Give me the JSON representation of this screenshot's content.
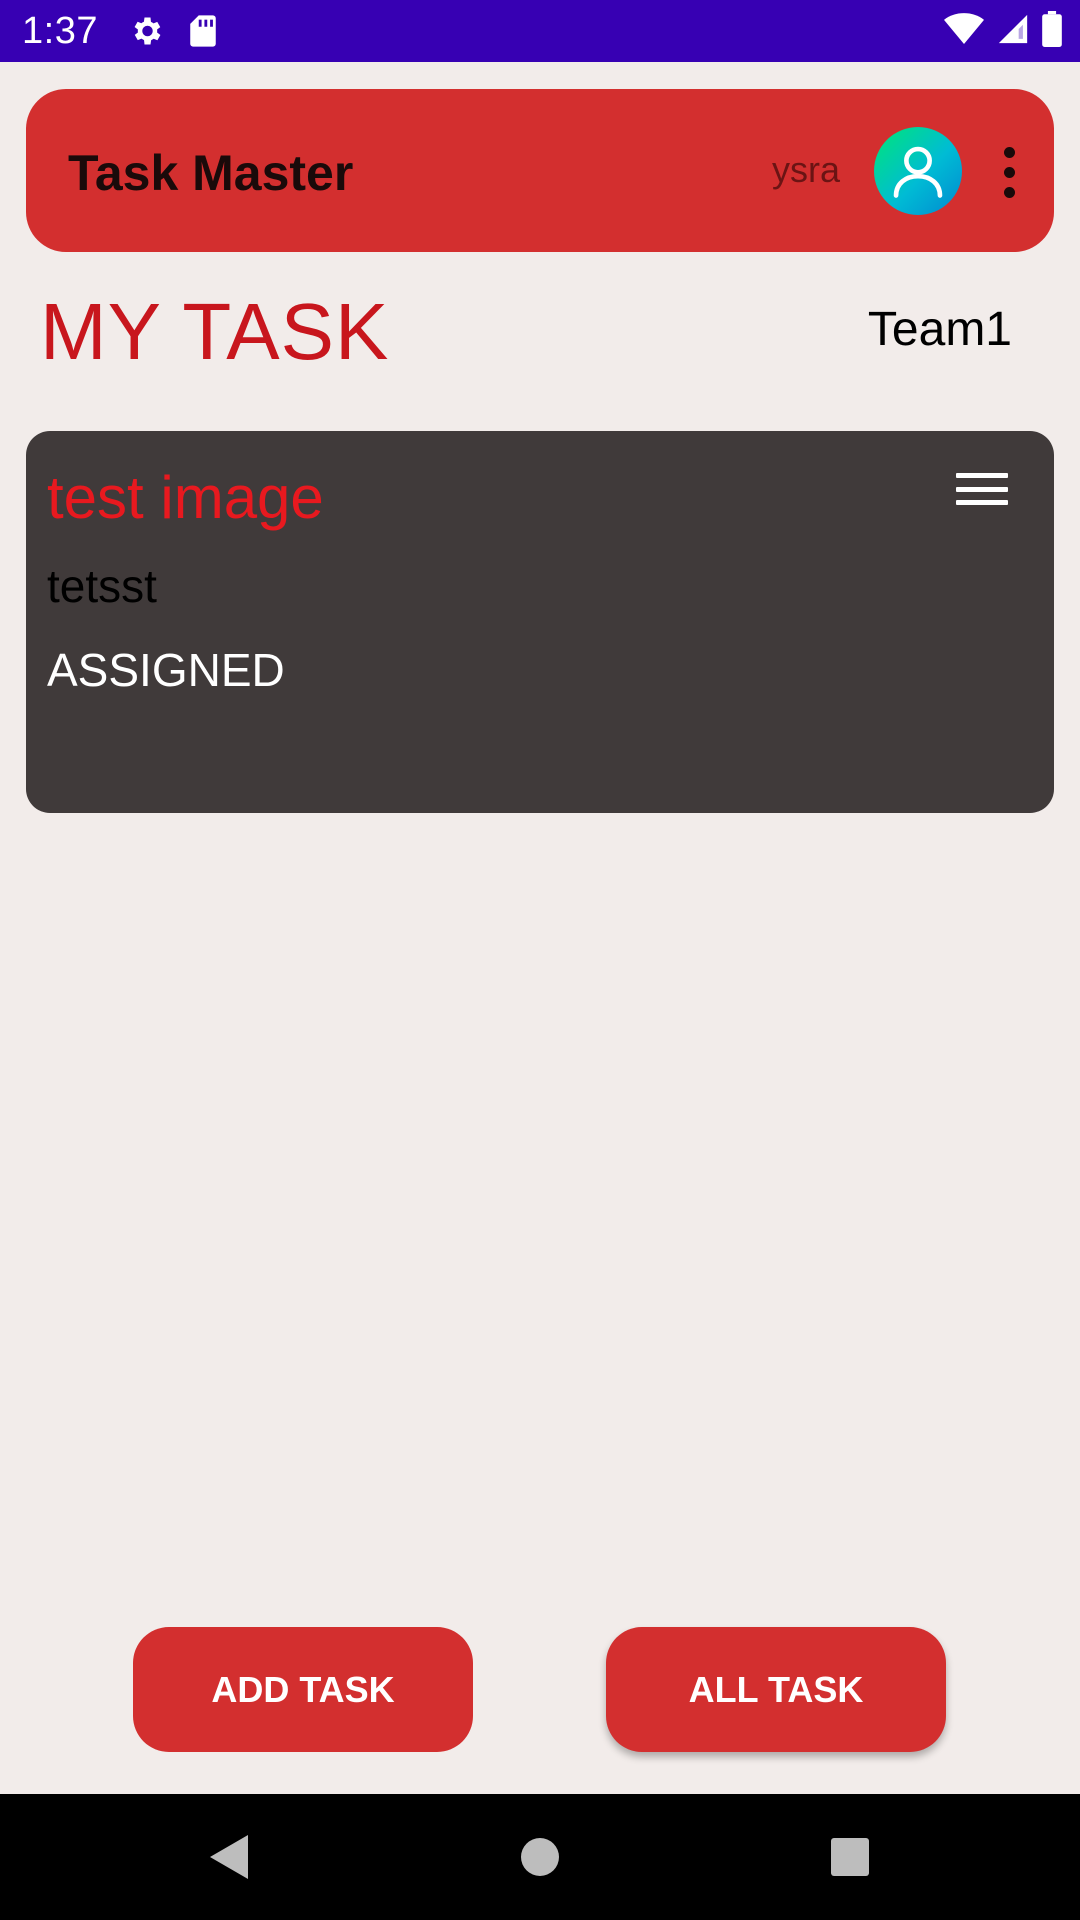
{
  "status_bar": {
    "time": "1:37",
    "icons": [
      "gear-icon",
      "sd-card-icon",
      "wifi-icon",
      "cellular-signal-icon",
      "battery-icon"
    ],
    "background": "#3700b3"
  },
  "app_bar": {
    "title": "Task Master",
    "username": "ysra",
    "avatar_icon": "user-avatar-icon",
    "more_icon": "more-vert-icon",
    "background": "#d32f2f"
  },
  "section": {
    "title": "MY TASK",
    "team": "Team1"
  },
  "tasks": [
    {
      "title": "test image",
      "description": "tetsst",
      "status": "ASSIGNED",
      "menu_icon": "hamburger-menu-icon"
    }
  ],
  "buttons": {
    "add_task": "ADD TASK",
    "all_task": "ALL TASK"
  },
  "nav_bar": {
    "icons": [
      "back-icon",
      "home-icon",
      "recents-icon"
    ]
  },
  "colors": {
    "accent": "#d32f2f",
    "title_red": "#c8161d",
    "card_background": "#403a3a",
    "page_background": "#f2ecea"
  }
}
